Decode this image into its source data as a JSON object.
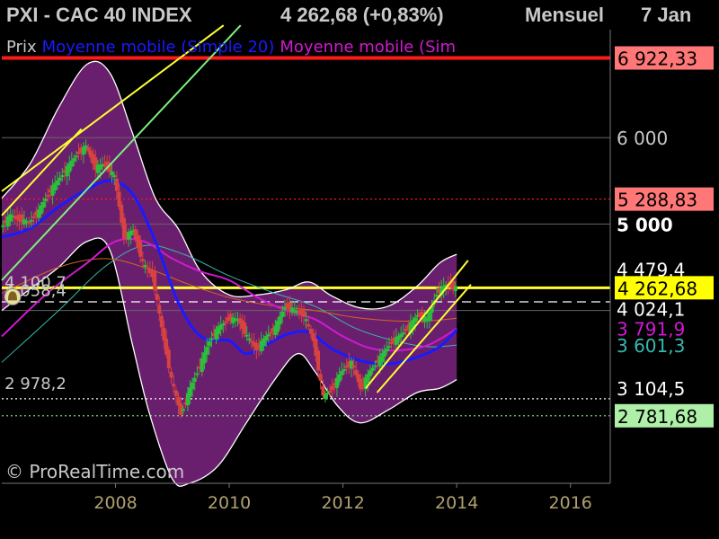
{
  "header": {
    "instrument": "PXI - CAC 40 INDEX",
    "quote": "4 262,68 (+0,83%)",
    "period": "Mensuel",
    "date": "7 Jan"
  },
  "legend": {
    "price": "Prix",
    "ma20": "Moyenne mobile (Simple 20)",
    "ma_other": "Moyenne mobile (Sim"
  },
  "copyright": "© ProRealTime.com",
  "colors": {
    "background": "#000000",
    "plot_border": "#777777",
    "candle_up": "#2bbf3c",
    "candle_down": "#d8423f",
    "bollinger_fill": "#6a1f6e",
    "bollinger_edge": "#ffffff",
    "ma_blue": "#1a1aff",
    "ma_magenta": "#d119d1",
    "ma_orange": "#d0671e",
    "ma_teal": "#36b8b0",
    "trend_yellow": "#ffff33",
    "trend_green": "#7df07d",
    "resistance_red": "#ff1a1a",
    "grid": "#666666"
  },
  "chart_data": {
    "type": "candlestick",
    "period": "monthly",
    "x_range": [
      2006.0,
      2016.7
    ],
    "y_range": [
      2000,
      7250
    ],
    "x_ticks": [
      "2008",
      "2010",
      "2012",
      "2014",
      "2016"
    ],
    "x_tick_values": [
      2008,
      2010,
      2012,
      2014,
      2016
    ],
    "y_grid": [
      6000,
      5000,
      4000
    ],
    "close_series": [
      [
        2006.0,
        4960
      ],
      [
        2006.17,
        5100
      ],
      [
        2006.33,
        5050
      ],
      [
        2006.5,
        5020
      ],
      [
        2006.67,
        5150
      ],
      [
        2006.83,
        5350
      ],
      [
        2007.0,
        5500
      ],
      [
        2007.17,
        5650
      ],
      [
        2007.33,
        5800
      ],
      [
        2007.5,
        5900
      ],
      [
        2007.67,
        5650
      ],
      [
        2007.83,
        5700
      ],
      [
        2008.0,
        5550
      ],
      [
        2008.17,
        4850
      ],
      [
        2008.33,
        4930
      ],
      [
        2008.5,
        4550
      ],
      [
        2008.67,
        4400
      ],
      [
        2008.83,
        3800
      ],
      [
        2009.0,
        3200
      ],
      [
        2009.17,
        2800
      ],
      [
        2009.33,
        3100
      ],
      [
        2009.5,
        3350
      ],
      [
        2009.67,
        3650
      ],
      [
        2009.83,
        3800
      ],
      [
        2010.0,
        3900
      ],
      [
        2010.17,
        3900
      ],
      [
        2010.33,
        3700
      ],
      [
        2010.5,
        3550
      ],
      [
        2010.67,
        3700
      ],
      [
        2010.83,
        3800
      ],
      [
        2011.0,
        4050
      ],
      [
        2011.17,
        4000
      ],
      [
        2011.33,
        3950
      ],
      [
        2011.5,
        3650
      ],
      [
        2011.67,
        3000
      ],
      [
        2011.83,
        3100
      ],
      [
        2012.0,
        3300
      ],
      [
        2012.17,
        3400
      ],
      [
        2012.33,
        3100
      ],
      [
        2012.5,
        3300
      ],
      [
        2012.67,
        3450
      ],
      [
        2012.83,
        3600
      ],
      [
        2013.0,
        3700
      ],
      [
        2013.17,
        3800
      ],
      [
        2013.33,
        3950
      ],
      [
        2013.5,
        3900
      ],
      [
        2013.67,
        4200
      ],
      [
        2013.83,
        4300
      ],
      [
        2014.0,
        4262.68
      ]
    ],
    "bollinger_upper": [
      [
        2006.0,
        5300
      ],
      [
        2006.5,
        5700
      ],
      [
        2007.0,
        6350
      ],
      [
        2007.5,
        6850
      ],
      [
        2007.9,
        6750
      ],
      [
        2008.3,
        6050
      ],
      [
        2008.7,
        5300
      ],
      [
        2009.1,
        4950
      ],
      [
        2009.5,
        4450
      ],
      [
        2010.0,
        4180
      ],
      [
        2010.5,
        4180
      ],
      [
        2011.0,
        4240
      ],
      [
        2011.4,
        4330
      ],
      [
        2011.8,
        4170
      ],
      [
        2012.3,
        4030
      ],
      [
        2012.8,
        4050
      ],
      [
        2013.3,
        4280
      ],
      [
        2013.7,
        4550
      ],
      [
        2014.0,
        4650
      ]
    ],
    "bollinger_lower": [
      [
        2006.0,
        4000
      ],
      [
        2006.5,
        4250
      ],
      [
        2007.0,
        4500
      ],
      [
        2007.5,
        4800
      ],
      [
        2007.9,
        4700
      ],
      [
        2008.3,
        3600
      ],
      [
        2008.6,
        2800
      ],
      [
        2009.0,
        2050
      ],
      [
        2009.3,
        2000
      ],
      [
        2009.8,
        2200
      ],
      [
        2010.3,
        2700
      ],
      [
        2010.8,
        3200
      ],
      [
        2011.2,
        3500
      ],
      [
        2011.5,
        3300
      ],
      [
        2011.9,
        2900
      ],
      [
        2012.3,
        2700
      ],
      [
        2012.8,
        2850
      ],
      [
        2013.3,
        3050
      ],
      [
        2013.7,
        3100
      ],
      [
        2014.0,
        3200
      ]
    ],
    "ma_simple_20": [
      [
        2006.0,
        4850
      ],
      [
        2006.5,
        4950
      ],
      [
        2007.0,
        5200
      ],
      [
        2007.5,
        5400
      ],
      [
        2007.9,
        5500
      ],
      [
        2008.3,
        5350
      ],
      [
        2008.7,
        4800
      ],
      [
        2009.1,
        4100
      ],
      [
        2009.5,
        3700
      ],
      [
        2010.0,
        3650
      ],
      [
        2010.3,
        3500
      ],
      [
        2010.7,
        3620
      ],
      [
        2011.0,
        3720
      ],
      [
        2011.4,
        3750
      ],
      [
        2011.8,
        3560
      ],
      [
        2012.3,
        3420
      ],
      [
        2012.8,
        3380
      ],
      [
        2013.3,
        3460
      ],
      [
        2013.7,
        3580
      ],
      [
        2014.0,
        3780
      ]
    ],
    "ma_magenta": [
      [
        2006.0,
        3700
      ],
      [
        2006.8,
        4200
      ],
      [
        2007.5,
        4550
      ],
      [
        2008.0,
        4800
      ],
      [
        2008.5,
        4800
      ],
      [
        2009.0,
        4600
      ],
      [
        2009.5,
        4450
      ],
      [
        2010.0,
        4350
      ],
      [
        2010.5,
        4150
      ],
      [
        2011.0,
        4000
      ],
      [
        2011.5,
        3900
      ],
      [
        2012.0,
        3700
      ],
      [
        2012.5,
        3560
      ],
      [
        2013.0,
        3540
      ],
      [
        2013.5,
        3600
      ],
      [
        2014.0,
        3790
      ]
    ],
    "ma_orange": [
      [
        2006.0,
        4200
      ],
      [
        2007.0,
        4500
      ],
      [
        2007.8,
        4600
      ],
      [
        2008.5,
        4500
      ],
      [
        2009.3,
        4300
      ],
      [
        2010.0,
        4150
      ],
      [
        2010.8,
        4050
      ],
      [
        2011.5,
        4000
      ],
      [
        2012.2,
        3920
      ],
      [
        2012.9,
        3880
      ],
      [
        2013.5,
        3880
      ],
      [
        2014.0,
        3910
      ]
    ],
    "ma_teal": [
      [
        2006.0,
        3400
      ],
      [
        2007.0,
        4000
      ],
      [
        2007.8,
        4500
      ],
      [
        2008.5,
        4750
      ],
      [
        2009.2,
        4650
      ],
      [
        2010.0,
        4400
      ],
      [
        2010.8,
        4200
      ],
      [
        2011.5,
        4050
      ],
      [
        2012.2,
        3800
      ],
      [
        2012.9,
        3650
      ],
      [
        2013.5,
        3580
      ],
      [
        2014.0,
        3600
      ]
    ],
    "trend_lines": [
      {
        "color": "yellow",
        "points": [
          [
            2006.0,
            5380
          ],
          [
            2009.9,
            7300
          ]
        ]
      },
      {
        "color": "green",
        "points": [
          [
            2006.0,
            4350
          ],
          [
            2010.2,
            7300
          ]
        ]
      },
      {
        "color": "yellow",
        "points": [
          [
            2006.0,
            5100
          ],
          [
            2007.4,
            6100
          ]
        ]
      },
      {
        "color": "yellow",
        "points": [
          [
            2012.4,
            3100
          ],
          [
            2014.2,
            4580
          ]
        ]
      },
      {
        "color": "yellow",
        "points": [
          [
            2012.6,
            3050
          ],
          [
            2014.25,
            4300
          ]
        ]
      }
    ],
    "horizontal_levels": [
      {
        "value": 6922.33,
        "style": "solid",
        "color": "red",
        "label": "6 922,33",
        "label_bg": "#ff7777",
        "label_fg": "#000000"
      },
      {
        "value": 5288.83,
        "style": "dotted",
        "color": "red",
        "label": "5 288,83",
        "label_bg": "#ff7777",
        "label_fg": "#000000"
      },
      {
        "value": 4262.68,
        "style": "solid",
        "color": "yellow",
        "label": "4 262,68",
        "label_bg": "#ffff00",
        "label_fg": "#000000"
      },
      {
        "value": 4100,
        "style": "dashed",
        "color": "white",
        "label": "",
        "label_bg": "",
        "label_fg": ""
      },
      {
        "value": 2978.2,
        "style": "dotted",
        "color": "white",
        "label": "",
        "label_bg": "",
        "label_fg": ""
      },
      {
        "value": 2781.68,
        "style": "dotted",
        "color": "green",
        "label": "2 781,68",
        "label_bg": "#aef0a8",
        "label_fg": "#000000"
      }
    ],
    "axis_labels": [
      {
        "text": "6 000",
        "value": 6000,
        "color": "#c8c8c8",
        "bold": false
      },
      {
        "text": "5 000",
        "value": 5000,
        "color": "#ffffff",
        "bold": true
      },
      {
        "text": "4 479,4",
        "value": 4479.4,
        "color": "#ffffff",
        "bold": false
      },
      {
        "text": "4 024,1",
        "value": 4024.1,
        "color": "#ffffff",
        "bold": false
      },
      {
        "text": "3 791,9",
        "value": 3791.9,
        "color": "#d119d1",
        "bold": false
      },
      {
        "text": "3 601,3",
        "value": 3601.3,
        "color": "#36b8b0",
        "bold": false
      },
      {
        "text": "3 104,5",
        "value": 3104.5,
        "color": "#ffffff",
        "bold": false
      }
    ],
    "in_chart_labels": [
      {
        "text": "4 100,7",
        "x": 2006.05,
        "value": 4260
      },
      {
        "text": "4 058,4",
        "x": 2006.05,
        "value": 4170
      },
      {
        "text": "2 978,2",
        "x": 2006.05,
        "value": 3090
      }
    ]
  }
}
